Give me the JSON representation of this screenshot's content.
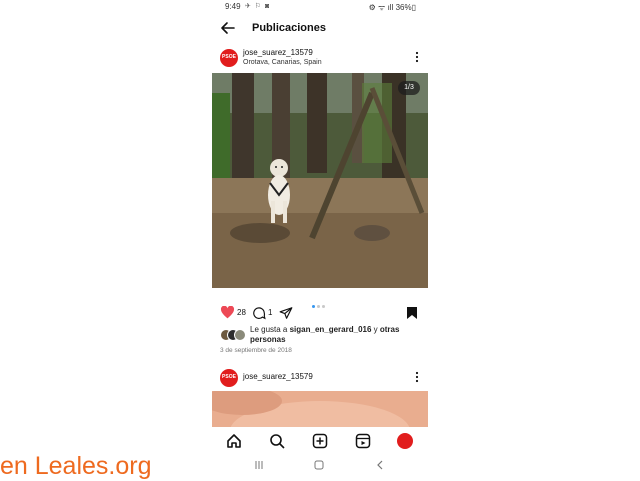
{
  "status_bar": {
    "time": "9:49",
    "left_icons": "✈ ⚐ ◙",
    "right_text": "⚙ ᯤ ıll 36%▯"
  },
  "header": {
    "title": "Publicaciones"
  },
  "posts": [
    {
      "avatar_text": "PSOE",
      "username": "jose_suarez_13579",
      "location": "Orotava, Canarias, Spain",
      "image_counter": "1/3",
      "likes_count": "28",
      "comments_count": "1",
      "liked_by_prefix": "Le gusta a ",
      "liked_by_user": "sigan_en_gerard_016",
      "liked_by_suffix": " y ",
      "liked_by_others": "otras personas",
      "date": "3 de septiembre de 2018"
    },
    {
      "avatar_text": "PSOE",
      "username": "jose_suarez_13579"
    }
  ],
  "watermark": "en Leales.org",
  "colors": {
    "heart": "#ed4956",
    "accent": "#3797f0",
    "avatar": "#e11d1d",
    "watermark": "#ee6a1f"
  },
  "icons": [
    "back-arrow-icon",
    "more-icon",
    "heart-icon",
    "comment-icon",
    "share-icon",
    "bookmark-icon",
    "home-icon",
    "search-icon",
    "create-icon",
    "reels-icon",
    "profile-icon"
  ]
}
